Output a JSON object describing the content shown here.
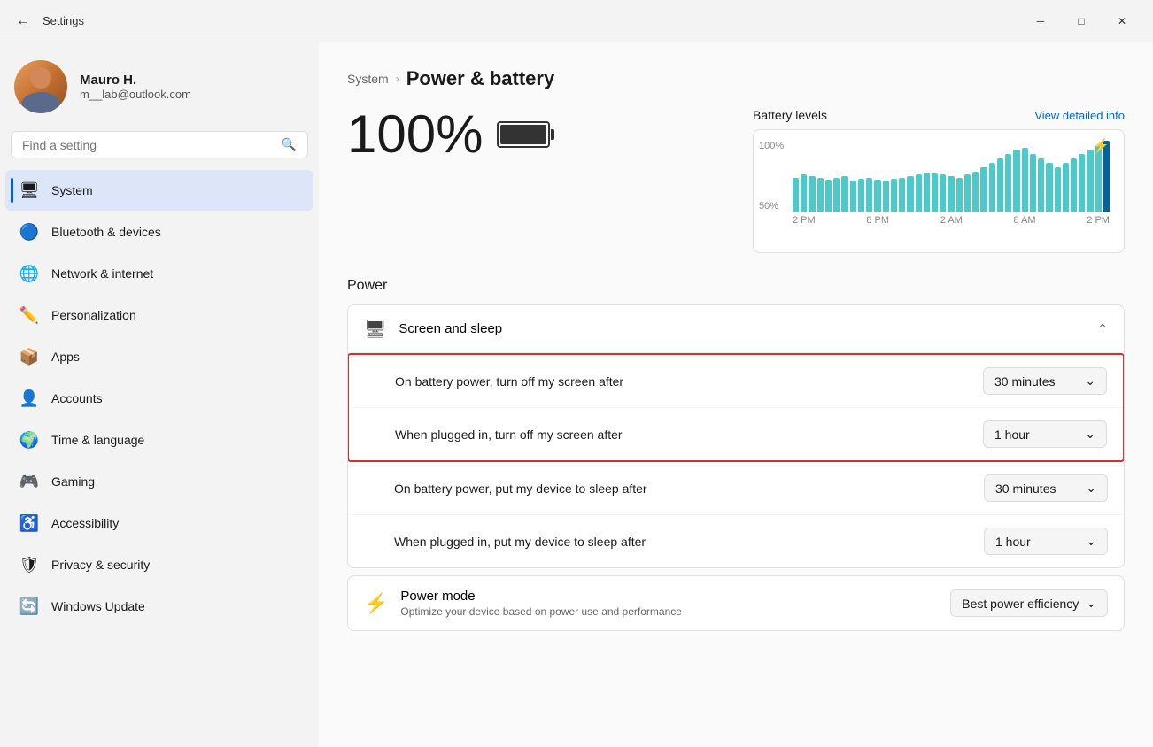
{
  "titlebar": {
    "title": "Settings",
    "min_btn": "─",
    "max_btn": "□",
    "close_btn": "✕"
  },
  "sidebar": {
    "user": {
      "name": "Mauro H.",
      "email": "m__lab@outlook.com"
    },
    "search": {
      "placeholder": "Find a setting"
    },
    "nav_items": [
      {
        "id": "system",
        "label": "System",
        "icon": "🖥",
        "active": true
      },
      {
        "id": "bluetooth",
        "label": "Bluetooth & devices",
        "icon": "🔵",
        "active": false
      },
      {
        "id": "network",
        "label": "Network & internet",
        "icon": "🌐",
        "active": false
      },
      {
        "id": "personalization",
        "label": "Personalization",
        "icon": "✏️",
        "active": false
      },
      {
        "id": "apps",
        "label": "Apps",
        "icon": "📦",
        "active": false
      },
      {
        "id": "accounts",
        "label": "Accounts",
        "icon": "👤",
        "active": false
      },
      {
        "id": "time",
        "label": "Time & language",
        "icon": "🌍",
        "active": false
      },
      {
        "id": "gaming",
        "label": "Gaming",
        "icon": "🎮",
        "active": false
      },
      {
        "id": "accessibility",
        "label": "Accessibility",
        "icon": "♿",
        "active": false
      },
      {
        "id": "privacy",
        "label": "Privacy & security",
        "icon": "🛡",
        "active": false
      },
      {
        "id": "update",
        "label": "Windows Update",
        "icon": "🔄",
        "active": false
      }
    ]
  },
  "content": {
    "breadcrumb_parent": "System",
    "breadcrumb_sep": "›",
    "breadcrumb_current": "Power & battery",
    "battery_percent": "100%",
    "battery_section": {
      "chart_title": "Battery levels",
      "chart_link": "View detailed info",
      "charge_indicator": "⚡",
      "x_labels": [
        "2 PM",
        "8 PM",
        "2 AM",
        "8 AM",
        "2 PM"
      ]
    },
    "power_section_title": "Power",
    "screen_sleep_label": "Screen and sleep",
    "power_settings": [
      {
        "label": "On battery power, turn off my screen after",
        "value": "30 minutes",
        "highlighted": true
      },
      {
        "label": "When plugged in, turn off my screen after",
        "value": "1 hour",
        "highlighted": true
      },
      {
        "label": "On battery power, put my device to sleep after",
        "value": "30 minutes",
        "highlighted": false
      },
      {
        "label": "When plugged in, put my device to sleep after",
        "value": "1 hour",
        "highlighted": false
      }
    ],
    "power_mode": {
      "title": "Power mode",
      "description": "Optimize your device based on power use and performance",
      "value": "Best power efficiency"
    }
  }
}
